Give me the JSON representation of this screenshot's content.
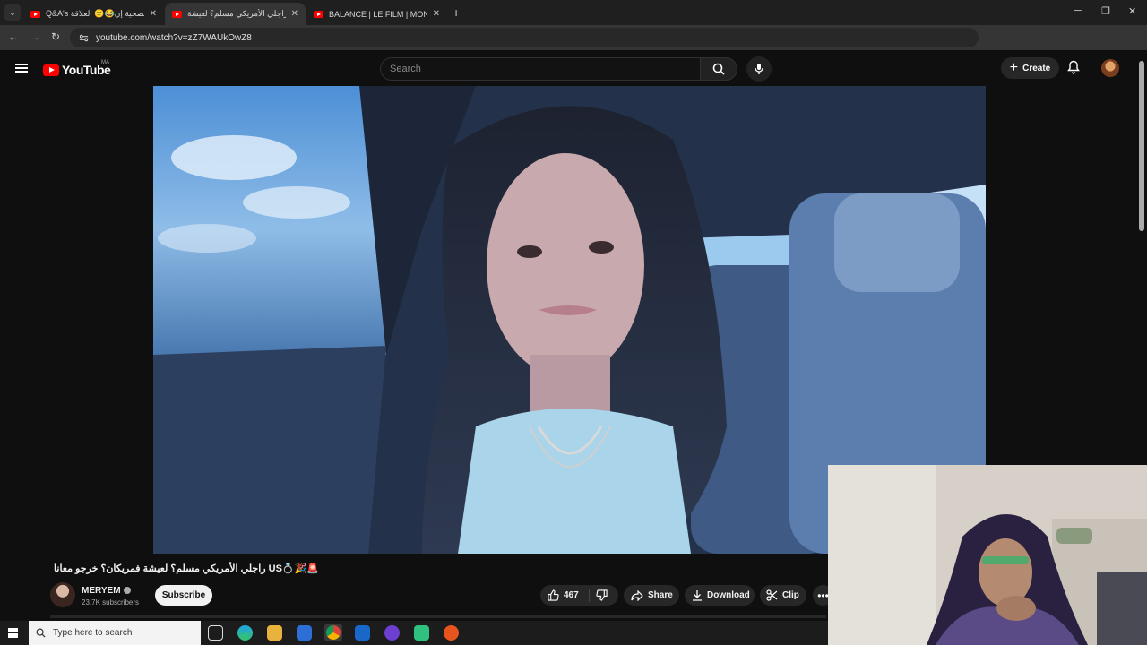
{
  "browser": {
    "tab_menu_icon": "chevron-down-icon",
    "tabs": [
      {
        "title": "Q&A's الصحية إن😂🙂 العلاقة",
        "close": "✕"
      },
      {
        "title": "راجلي الأمريكي مسلم؟ لعيشة",
        "close": "✕"
      },
      {
        "title": "BALANCE | LE FILM | MON TOU",
        "close": "✕"
      }
    ],
    "new_tab": "+",
    "window_controls": {
      "minimize": "─",
      "restore": "❐",
      "close": "✕"
    },
    "nav": {
      "back": "←",
      "forward": "→",
      "reload": "↻"
    },
    "url": "youtube.com/watch?v=zZ7WAUkOwZ8"
  },
  "youtube": {
    "logo_text": "YouTube",
    "country_code": "MA",
    "search_placeholder": "Search",
    "create_label": "Create",
    "create_plus": "+"
  },
  "video": {
    "title": "🚨🎉💍US راجلي الأمريكي مسلم؟ لعيشة فمريكان؟ خرجو معانا",
    "channel_name": "MERYEM",
    "subscribers": "23.7K subscribers",
    "subscribe_label": "Subscribe",
    "likes": "467",
    "share_label": "Share",
    "download_label": "Download",
    "clip_label": "Clip",
    "more_label": "•••"
  },
  "taskbar": {
    "search_placeholder": "Type here to search"
  },
  "colors": {
    "brand_red": "#ff0000",
    "background": "#0f0f0f",
    "pill": "#272727"
  }
}
